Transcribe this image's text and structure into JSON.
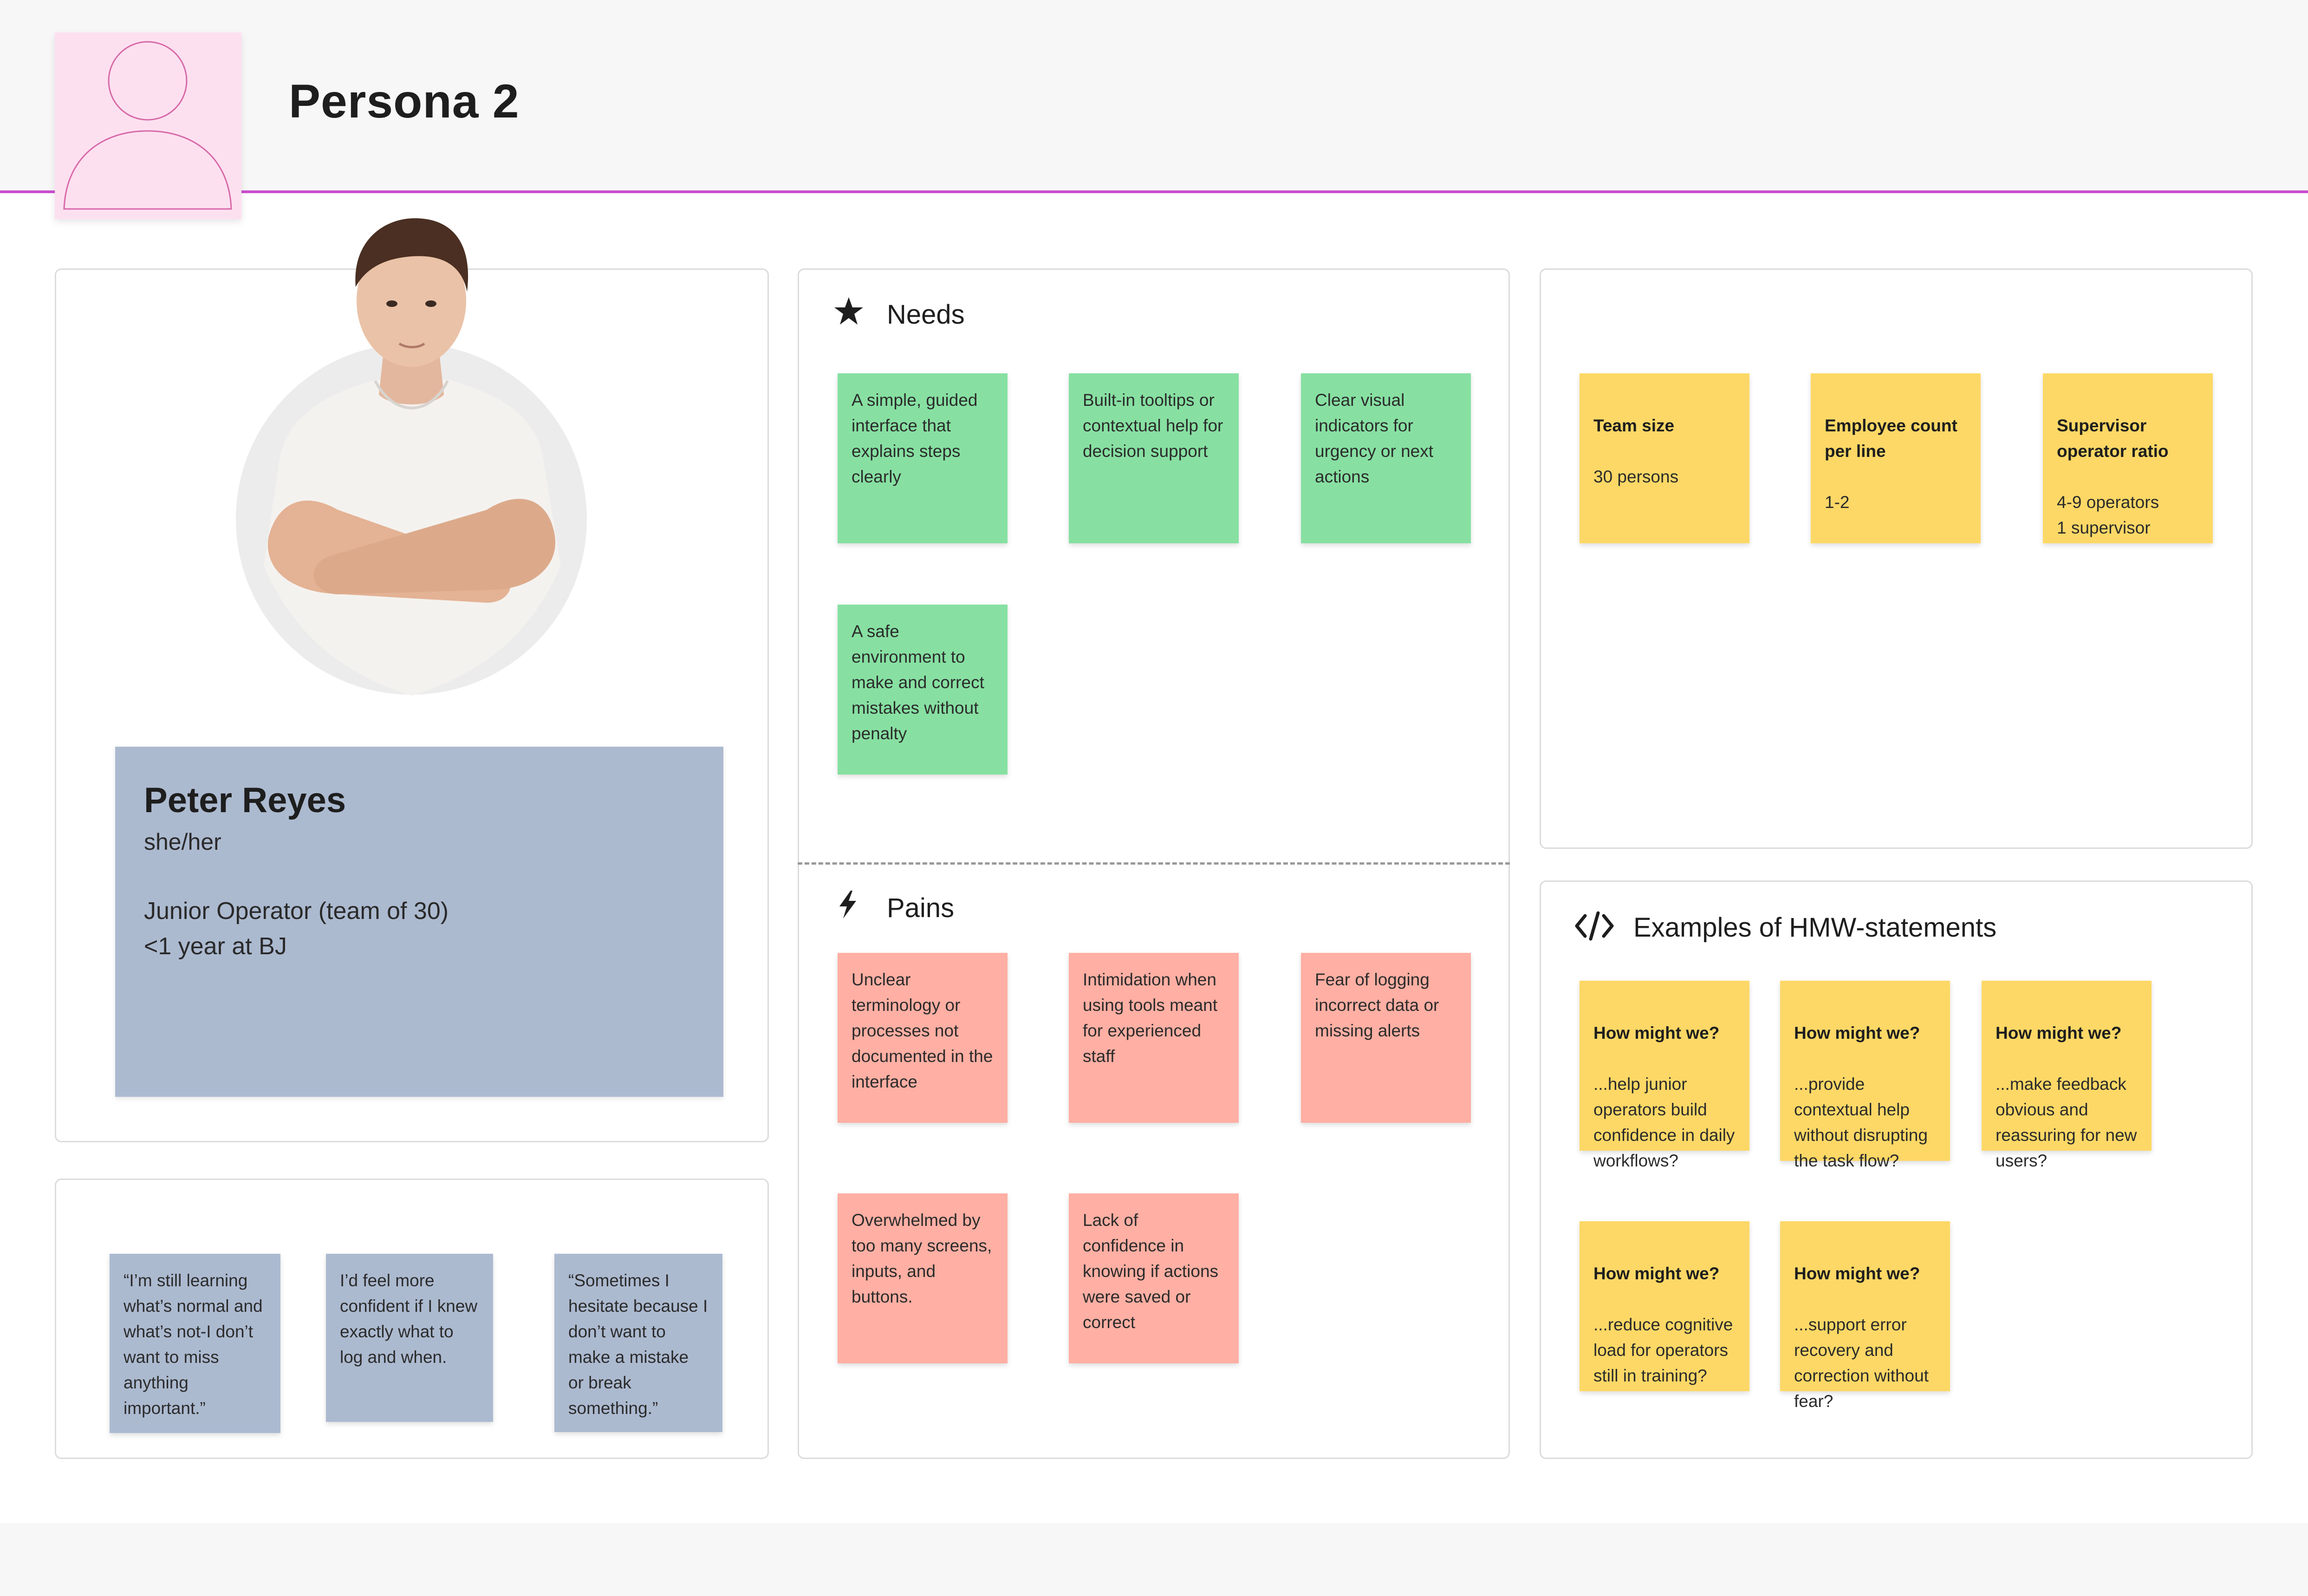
{
  "header": {
    "title": "Persona 2",
    "avatar_icon": "user-placeholder-icon"
  },
  "persona": {
    "photo_icon": "person-photo",
    "name": "Peter Reyes",
    "pronouns": "she/her",
    "role": "Junior Operator (team of 30)",
    "tenure": "<1 year at BJ"
  },
  "quotes": [
    "“I’m still learning what’s normal and what’s not-I don’t want to miss anything important.”",
    "I’d feel more confident if I knew exactly what to log and when.",
    "“Sometimes I hesitate because I don’t want to make a mistake or break something.”"
  ],
  "needs": {
    "heading": "Needs",
    "icon": "star-icon",
    "items": [
      "A simple, guided interface that explains steps clearly",
      "Built-in tooltips or contextual help for decision support",
      "Clear visual indicators for urgency or next actions",
      "A safe environment to make and correct mistakes without penalty"
    ]
  },
  "pains": {
    "heading": "Pains",
    "icon": "lightning-icon",
    "items": [
      "Unclear terminology or processes not documented in the interface",
      "Intimidation when using tools meant for experienced staff",
      "Fear of logging incorrect data or missing alerts",
      "Overwhelmed by too many screens, inputs, and buttons.",
      "Lack of confidence in knowing if actions were saved or correct"
    ]
  },
  "facts": [
    {
      "label": "Team size",
      "value": "30 persons"
    },
    {
      "label": "Employee count per line",
      "value": "1-2"
    },
    {
      "label": "Supervisor operator ratio",
      "value": "4-9 operators\n1 supervisor"
    }
  ],
  "hmw": {
    "heading": "Examples of HMW-statements",
    "icon": "code-icon",
    "items": [
      {
        "lead": "How might we?",
        "text": "...help junior operators build confidence in daily workflows?"
      },
      {
        "lead": "How might we?",
        "text": "...provide contextual help without disrupting the task flow?"
      },
      {
        "lead": "How might we?",
        "text": "...make feedback obvious and reassuring for new users?"
      },
      {
        "lead": "How might we?",
        "text": "...reduce cognitive load for operators still in training?"
      },
      {
        "lead": "How might we?",
        "text": "...support error recovery and correction without fear?"
      }
    ]
  },
  "colors": {
    "accent": "#c94fce",
    "needs_sticky": "#87e0a2",
    "pains_sticky": "#ffafa3",
    "facts_sticky": "#fdd866",
    "quote_sticky": "#acbad0",
    "avatar_bg": "#fde0f0"
  }
}
